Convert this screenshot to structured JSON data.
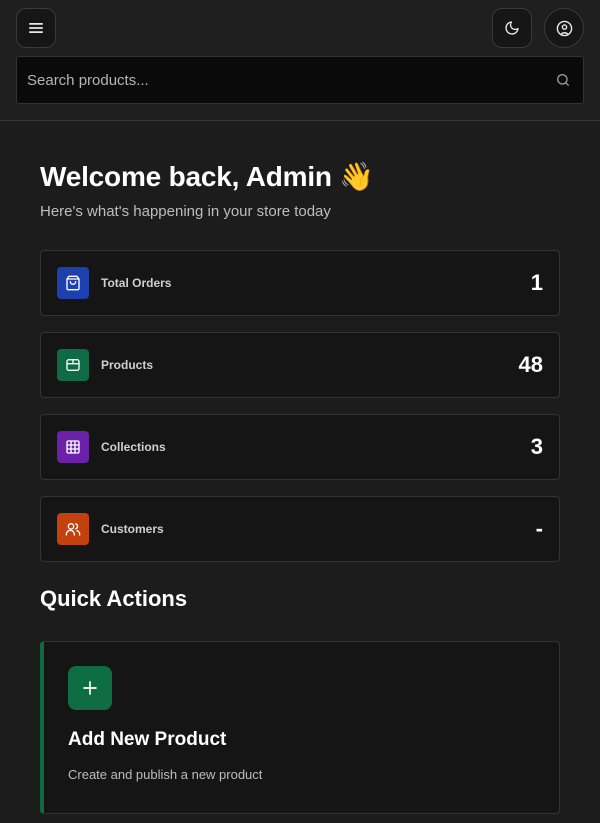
{
  "header": {
    "search_placeholder": "Search products..."
  },
  "welcome": {
    "title": "Welcome back, Admin 👋",
    "subtitle": "Here's what's happening in your store today"
  },
  "stats": [
    {
      "label": "Total Orders",
      "value": "1",
      "icon": "shopping-bag-icon",
      "color": "#1e40af"
    },
    {
      "label": "Products",
      "value": "48",
      "icon": "package-icon",
      "color": "#0f6b46"
    },
    {
      "label": "Collections",
      "value": "3",
      "icon": "grid-icon",
      "color": "#6b21a8"
    },
    {
      "label": "Customers",
      "value": "-",
      "icon": "users-icon",
      "color": "#c2410c"
    }
  ],
  "quick_actions": {
    "title": "Quick Actions",
    "items": [
      {
        "title": "Add New Product",
        "description": "Create and publish a new product",
        "icon": "plus-icon",
        "color": "#0f6d43"
      }
    ]
  }
}
